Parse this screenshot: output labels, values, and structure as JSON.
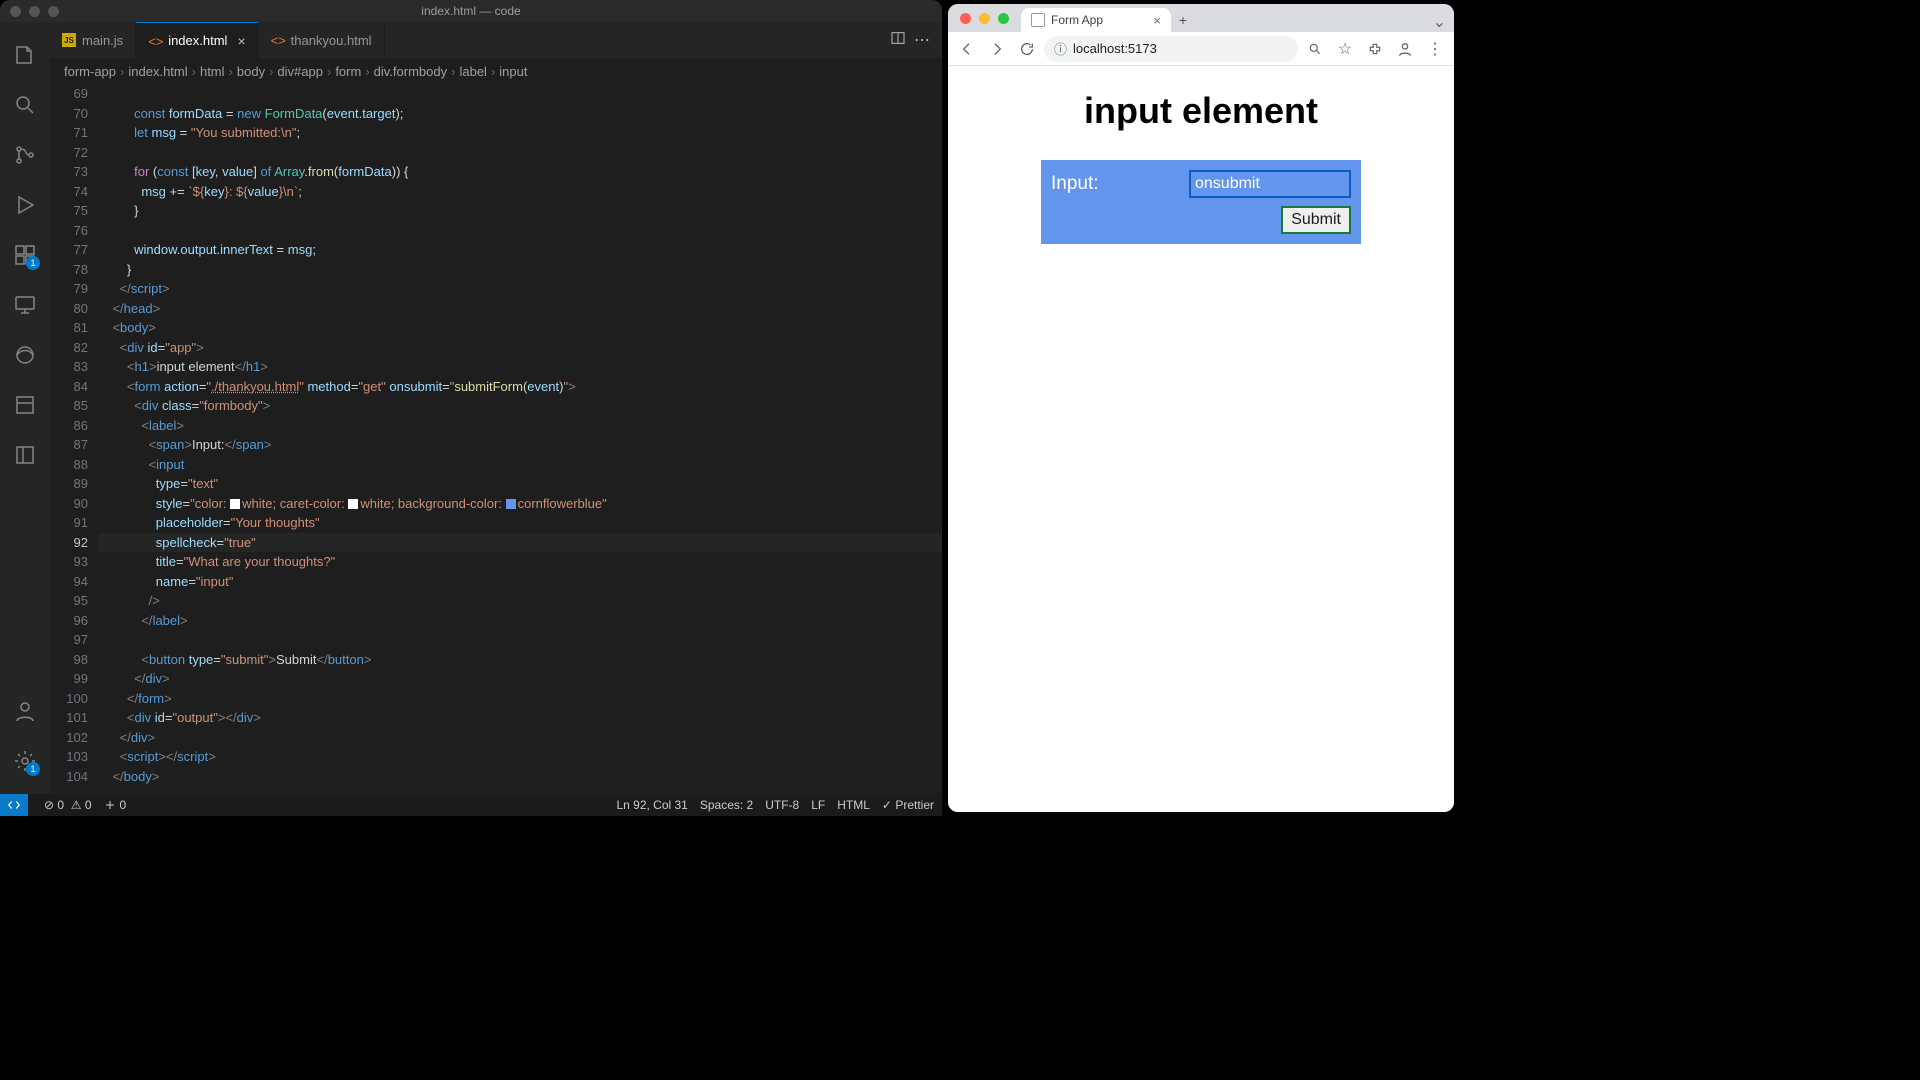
{
  "vscode": {
    "window_title": "index.html — code",
    "tabs": [
      {
        "label": "main.js",
        "icon": "js-icon",
        "active": false,
        "closeable": false
      },
      {
        "label": "index.html",
        "icon": "html-icon",
        "active": true,
        "closeable": true
      },
      {
        "label": "thankyou.html",
        "icon": "html-icon",
        "active": false,
        "closeable": false
      }
    ],
    "breadcrumbs": [
      "form-app",
      "index.html",
      "html",
      "body",
      "div#app",
      "form",
      "div.formbody",
      "label",
      "input"
    ],
    "activity_badge_ext": "1",
    "activity_badge_settings": "1",
    "lines_start": 69,
    "code_lines": [
      {
        "n": 69,
        "html": ""
      },
      {
        "n": 70,
        "html": "          <span class='c-blue'>const</span> <span class='c-var'>formData</span> <span class='c-pun'>=</span> <span class='c-blue'>new</span> <span class='c-cls'>FormData</span><span class='c-pun'>(</span><span class='c-var'>event</span><span class='c-pun'>.</span><span class='c-var'>target</span><span class='c-pun'>);</span>"
      },
      {
        "n": 71,
        "html": "          <span class='c-blue'>let</span> <span class='c-var'>msg</span> <span class='c-pun'>=</span> <span class='c-str'>\"You submitted:\\n\"</span><span class='c-pun'>;</span>"
      },
      {
        "n": 72,
        "html": ""
      },
      {
        "n": 73,
        "html": "          <span class='c-kw'>for</span> <span class='c-pun'>(</span><span class='c-blue'>const</span> <span class='c-pun'>[</span><span class='c-var'>key</span><span class='c-pun'>,</span> <span class='c-var'>value</span><span class='c-pun'>]</span> <span class='c-blue'>of</span> <span class='c-cls'>Array</span><span class='c-pun'>.</span><span class='c-fn'>from</span><span class='c-pun'>(</span><span class='c-var'>formData</span><span class='c-pun'>)) {</span>"
      },
      {
        "n": 74,
        "html": "            <span class='c-var'>msg</span> <span class='c-pun'>+=</span> <span class='c-str'>`${</span><span class='c-var'>key</span><span class='c-str'>}: ${</span><span class='c-var'>value</span><span class='c-str'>}\\n`</span><span class='c-pun'>;</span>"
      },
      {
        "n": 75,
        "html": "          <span class='c-pun'>}</span>"
      },
      {
        "n": 76,
        "html": ""
      },
      {
        "n": 77,
        "html": "          <span class='c-var'>window</span><span class='c-pun'>.</span><span class='c-var'>output</span><span class='c-pun'>.</span><span class='c-var'>innerText</span> <span class='c-pun'>=</span> <span class='c-var'>msg</span><span class='c-pun'>;</span>"
      },
      {
        "n": 78,
        "html": "        <span class='c-pun'>}</span>"
      },
      {
        "n": 79,
        "html": "      <span class='c-tag'>&lt;/</span><span class='c-tagn'>script</span><span class='c-tag'>&gt;</span>"
      },
      {
        "n": 80,
        "html": "    <span class='c-tag'>&lt;/</span><span class='c-tagn'>head</span><span class='c-tag'>&gt;</span>"
      },
      {
        "n": 81,
        "html": "    <span class='c-tag'>&lt;</span><span class='c-tagn'>body</span><span class='c-tag'>&gt;</span>"
      },
      {
        "n": 82,
        "html": "      <span class='c-tag'>&lt;</span><span class='c-tagn'>div</span> <span class='c-attr'>id</span><span class='c-pun'>=</span><span class='c-str'>\"app\"</span><span class='c-tag'>&gt;</span>"
      },
      {
        "n": 83,
        "html": "        <span class='c-tag'>&lt;</span><span class='c-tagn'>h1</span><span class='c-tag'>&gt;</span>input element<span class='c-tag'>&lt;/</span><span class='c-tagn'>h1</span><span class='c-tag'>&gt;</span>"
      },
      {
        "n": 84,
        "html": "        <span class='c-tag'>&lt;</span><span class='c-tagn'>form</span> <span class='c-attr'>action</span><span class='c-pun'>=</span><span class='c-str'>\"<u style='text-decoration-style:dotted'>./thankyou.html</u>\"</span> <span class='c-attr'>method</span><span class='c-pun'>=</span><span class='c-str'>\"get\"</span> <span class='c-attr'>onsubmit</span><span class='c-pun'>=</span><span class='c-str'>\"</span><span class='c-fn'>submitForm</span><span class='c-pun'>(</span><span class='c-var'>event</span><span class='c-pun'>)</span><span class='c-str'>\"</span><span class='c-tag'>&gt;</span>"
      },
      {
        "n": 85,
        "html": "          <span class='c-tag'>&lt;</span><span class='c-tagn'>div</span> <span class='c-attr'>class</span><span class='c-pun'>=</span><span class='c-str'>\"formbody\"</span><span class='c-tag'>&gt;</span>"
      },
      {
        "n": 86,
        "html": "            <span class='c-tag'>&lt;</span><span class='c-tagn'>label</span><span class='c-tag'>&gt;</span>"
      },
      {
        "n": 87,
        "html": "              <span class='c-tag'>&lt;</span><span class='c-tagn'>span</span><span class='c-tag'>&gt;</span>Input:<span class='c-tag'>&lt;/</span><span class='c-tagn'>span</span><span class='c-tag'>&gt;</span>"
      },
      {
        "n": 88,
        "html": "              <span class='c-tag'>&lt;</span><span class='c-tagn'>input</span>"
      },
      {
        "n": 89,
        "html": "                <span class='c-attr'>type</span><span class='c-pun'>=</span><span class='c-str'>\"text\"</span>"
      },
      {
        "n": 90,
        "html": "                <span class='c-attr'>style</span><span class='c-pun'>=</span><span class='c-str'>\"color: <span class='c-swatch' style='background:#fff'></span>white; caret-color: <span class='c-swatch' style='background:#fff'></span>white; background-color: <span class='c-swatch' style='background:#6495ed'></span>cornflowerblue\"</span>"
      },
      {
        "n": 91,
        "html": "                <span class='c-attr'>placeholder</span><span class='c-pun'>=</span><span class='c-str'>\"Your thoughts\"</span>"
      },
      {
        "n": 92,
        "html": "                <span class='c-attr'>spellcheck</span><span class='c-pun'>=</span><span class='c-str'>\"true\"</span>"
      },
      {
        "n": 93,
        "html": "                <span class='c-attr'>title</span><span class='c-pun'>=</span><span class='c-str'>\"What are your thoughts?\"</span>"
      },
      {
        "n": 94,
        "html": "                <span class='c-attr'>name</span><span class='c-pun'>=</span><span class='c-str'>\"input\"</span>"
      },
      {
        "n": 95,
        "html": "              <span class='c-tag'>/&gt;</span>"
      },
      {
        "n": 96,
        "html": "            <span class='c-tag'>&lt;/</span><span class='c-tagn'>label</span><span class='c-tag'>&gt;</span>"
      },
      {
        "n": 97,
        "html": ""
      },
      {
        "n": 98,
        "html": "            <span class='c-tag'>&lt;</span><span class='c-tagn'>button</span> <span class='c-attr'>type</span><span class='c-pun'>=</span><span class='c-str'>\"submit\"</span><span class='c-tag'>&gt;</span>Submit<span class='c-tag'>&lt;/</span><span class='c-tagn'>button</span><span class='c-tag'>&gt;</span>"
      },
      {
        "n": 99,
        "html": "          <span class='c-tag'>&lt;/</span><span class='c-tagn'>div</span><span class='c-tag'>&gt;</span>"
      },
      {
        "n": 100,
        "html": "        <span class='c-tag'>&lt;/</span><span class='c-tagn'>form</span><span class='c-tag'>&gt;</span>"
      },
      {
        "n": 101,
        "html": "        <span class='c-tag'>&lt;</span><span class='c-tagn'>div</span> <span class='c-attr'>id</span><span class='c-pun'>=</span><span class='c-str'>\"output\"</span><span class='c-tag'>&gt;&lt;/</span><span class='c-tagn'>div</span><span class='c-tag'>&gt;</span>"
      },
      {
        "n": 102,
        "html": "      <span class='c-tag'>&lt;/</span><span class='c-tagn'>div</span><span class='c-tag'>&gt;</span>"
      },
      {
        "n": 103,
        "html": "      <span class='c-tag'>&lt;</span><span class='c-tagn'>script</span><span class='c-tag'>&gt;&lt;/</span><span class='c-tagn'>script</span><span class='c-tag'>&gt;</span>"
      },
      {
        "n": 104,
        "html": "    <span class='c-tag'>&lt;/</span><span class='c-tagn'>body</span><span class='c-tag'>&gt;</span>"
      }
    ],
    "status": {
      "errors": "0",
      "warnings": "0",
      "ports": "0",
      "cursor": "Ln 92, Col 31",
      "spaces": "Spaces: 2",
      "encoding": "UTF-8",
      "eol": "LF",
      "language": "HTML",
      "formatter": "Prettier"
    }
  },
  "browser": {
    "tab_title": "Form App",
    "url": "localhost:5173",
    "page": {
      "heading": "input element",
      "label": "Input:",
      "input_value": "onsubmit ",
      "submit_label": "Submit"
    }
  }
}
